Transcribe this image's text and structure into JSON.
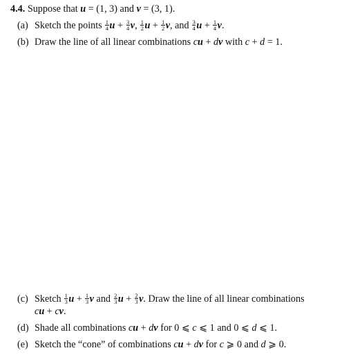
{
  "problem": {
    "number": "4.4.",
    "intro": [
      {
        "t": "text",
        "v": " Suppose that "
      },
      {
        "t": "bv",
        "v": "u"
      },
      {
        "t": "text",
        "v": " = (1, 3) and "
      },
      {
        "t": "bv",
        "v": "v"
      },
      {
        "t": "text",
        "v": " = (3, 1)."
      }
    ],
    "parts": [
      {
        "label": "(a)",
        "lines": [
          [
            {
              "t": "text",
              "v": "Sketch the points "
            },
            {
              "t": "frac",
              "n": "1",
              "d": "4"
            },
            {
              "t": "bv",
              "v": "u"
            },
            {
              "t": "text",
              "v": " + "
            },
            {
              "t": "frac",
              "n": "3",
              "d": "4"
            },
            {
              "t": "bv",
              "v": "v"
            },
            {
              "t": "text",
              "v": ", "
            },
            {
              "t": "frac",
              "n": "1",
              "d": "2"
            },
            {
              "t": "bv",
              "v": "u"
            },
            {
              "t": "text",
              "v": " + "
            },
            {
              "t": "frac",
              "n": "1",
              "d": "2"
            },
            {
              "t": "bv",
              "v": "v"
            },
            {
              "t": "text",
              "v": ", and "
            },
            {
              "t": "frac",
              "n": "3",
              "d": "4"
            },
            {
              "t": "bv",
              "v": "u"
            },
            {
              "t": "text",
              "v": " + "
            },
            {
              "t": "frac",
              "n": "1",
              "d": "4"
            },
            {
              "t": "bv",
              "v": "v"
            },
            {
              "t": "text",
              "v": "."
            }
          ]
        ]
      },
      {
        "label": "(b)",
        "lines": [
          [
            {
              "t": "text",
              "v": "Draw the line of all linear combinations "
            },
            {
              "t": "it",
              "v": "c"
            },
            {
              "t": "bv",
              "v": "u"
            },
            {
              "t": "text",
              "v": " + "
            },
            {
              "t": "it",
              "v": "d"
            },
            {
              "t": "bv",
              "v": "v"
            },
            {
              "t": "text",
              "v": " with "
            },
            {
              "t": "it",
              "v": "c"
            },
            {
              "t": "text",
              "v": " + "
            },
            {
              "t": "it",
              "v": "d"
            },
            {
              "t": "text",
              "v": " = 1."
            }
          ]
        ]
      },
      {
        "label": "(c)",
        "lines": [
          [
            {
              "t": "text",
              "v": "Sketch "
            },
            {
              "t": "frac",
              "n": "1",
              "d": "3"
            },
            {
              "t": "bv",
              "v": "u"
            },
            {
              "t": "text",
              "v": " + "
            },
            {
              "t": "frac",
              "n": "1",
              "d": "3"
            },
            {
              "t": "bv",
              "v": "v"
            },
            {
              "t": "text",
              "v": " and "
            },
            {
              "t": "frac",
              "n": "2",
              "d": "3"
            },
            {
              "t": "bv",
              "v": "u"
            },
            {
              "t": "text",
              "v": " + "
            },
            {
              "t": "frac",
              "n": "2",
              "d": "3"
            },
            {
              "t": "bv",
              "v": "v"
            },
            {
              "t": "text",
              "v": ". Draw the line of all linear combinations"
            }
          ],
          [
            {
              "t": "it",
              "v": "c"
            },
            {
              "t": "bv",
              "v": "u"
            },
            {
              "t": "text",
              "v": " + "
            },
            {
              "t": "it",
              "v": "c"
            },
            {
              "t": "bv",
              "v": "v"
            },
            {
              "t": "text",
              "v": "."
            }
          ]
        ]
      },
      {
        "label": "(d)",
        "lines": [
          [
            {
              "t": "text",
              "v": "Shade all combinations "
            },
            {
              "t": "it",
              "v": "c"
            },
            {
              "t": "bv",
              "v": "u"
            },
            {
              "t": "text",
              "v": " + "
            },
            {
              "t": "it",
              "v": "d"
            },
            {
              "t": "bv",
              "v": "v"
            },
            {
              "t": "text",
              "v": " for 0 ⩽ "
            },
            {
              "t": "it",
              "v": "c"
            },
            {
              "t": "text",
              "v": " ⩽ 1 and 0 ⩽ "
            },
            {
              "t": "it",
              "v": "d"
            },
            {
              "t": "text",
              "v": " ⩽ 1."
            }
          ]
        ]
      },
      {
        "label": "(e)",
        "lines": [
          [
            {
              "t": "text",
              "v": "Sketch the “cone” of combinations "
            },
            {
              "t": "it",
              "v": "c"
            },
            {
              "t": "bv",
              "v": "u"
            },
            {
              "t": "text",
              "v": " + "
            },
            {
              "t": "it",
              "v": "d"
            },
            {
              "t": "bv",
              "v": "v"
            },
            {
              "t": "text",
              "v": " for "
            },
            {
              "t": "it",
              "v": "c"
            },
            {
              "t": "text",
              "v": " ⩾ 0 and "
            },
            {
              "t": "it",
              "v": "d"
            },
            {
              "t": "text",
              "v": " ⩾ 0."
            }
          ]
        ]
      }
    ]
  }
}
